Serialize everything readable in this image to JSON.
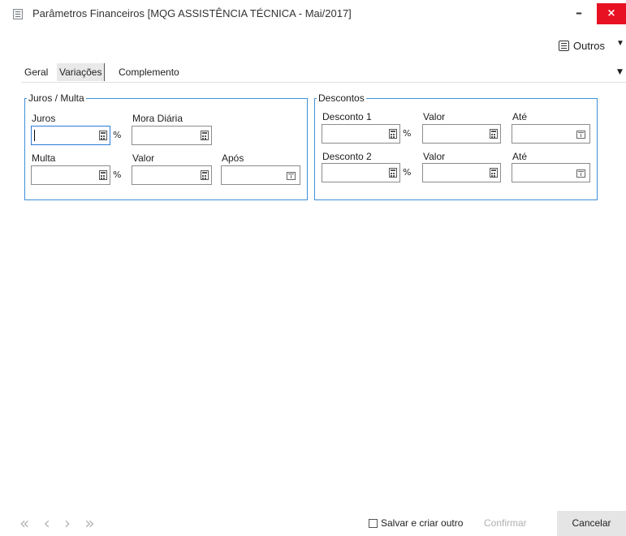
{
  "window": {
    "title": "Parâmetros Financeiros [MQG ASSISTÊNCIA TÉCNICA - Mai/2017]",
    "min_label": "–",
    "close_label": "×"
  },
  "toolbar": {
    "outros_label": "Outros"
  },
  "tabs": [
    {
      "label": "Geral"
    },
    {
      "label": "Variações",
      "active": true
    },
    {
      "label": "Complemento"
    }
  ],
  "juros_multa": {
    "legend": "Juros / Multa",
    "juros_label": "Juros",
    "juros_value": "",
    "mora_label": "Mora Diária",
    "mora_value": "",
    "multa_label": "Multa",
    "multa_value": "",
    "valor_label": "Valor",
    "valor_value": "",
    "apos_label": "Após",
    "apos_value": "",
    "percent": "%"
  },
  "descontos": {
    "legend": "Descontos",
    "d1_label": "Desconto 1",
    "d1_value": "",
    "d1_valor_label": "Valor",
    "d1_valor_value": "",
    "d1_ate_label": "Até",
    "d1_ate_value": "",
    "d2_label": "Desconto 2",
    "d2_value": "",
    "d2_valor_label": "Valor",
    "d2_valor_value": "",
    "d2_ate_label": "Até",
    "d2_ate_value": "",
    "percent": "%"
  },
  "footer": {
    "nav_first": "«",
    "nav_prev": "‹",
    "nav_next": "›",
    "nav_last": "»",
    "save_and_new_label": "Salvar e criar outro",
    "confirm_label": "Confirmar",
    "cancel_label": "Cancelar"
  },
  "colors": {
    "accent": "#3f8fd8",
    "close": "#e81123"
  }
}
